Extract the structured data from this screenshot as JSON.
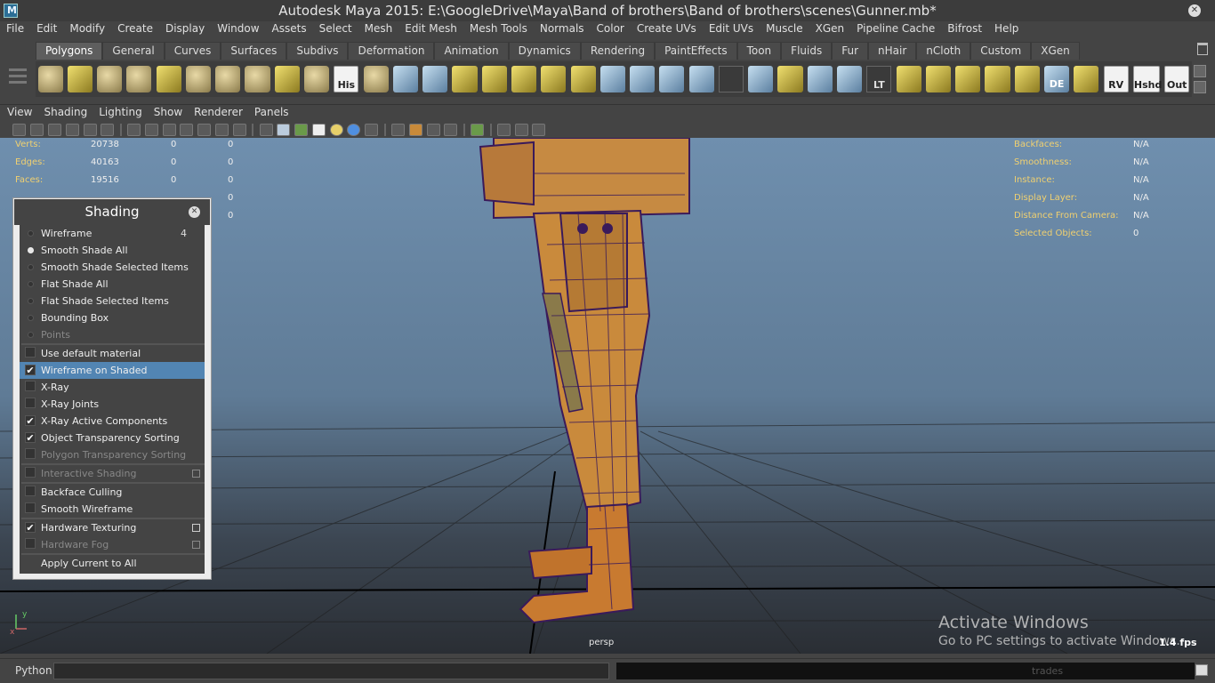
{
  "window": {
    "title": "Autodesk Maya 2015: E:\\GoogleDrive\\Maya\\Band of brothers\\Band of brothers\\scenes\\Gunner.mb*"
  },
  "menubar": [
    "File",
    "Edit",
    "Modify",
    "Create",
    "Display",
    "Window",
    "Assets",
    "Select",
    "Mesh",
    "Edit Mesh",
    "Mesh Tools",
    "Normals",
    "Color",
    "Create UVs",
    "Edit UVs",
    "Muscle",
    "XGen",
    "Pipeline Cache",
    "Bifrost",
    "Help"
  ],
  "shelf": {
    "tabs": [
      "Polygons",
      "General",
      "Curves",
      "Surfaces",
      "Subdivs",
      "Deformation",
      "Animation",
      "Dynamics",
      "Rendering",
      "PaintEffects",
      "Toon",
      "Fluids",
      "Fur",
      "nHair",
      "nCloth",
      "Custom",
      "XGen"
    ],
    "active_tab": "Polygons",
    "icon_labels": {
      "his": "His",
      "lt": "LT",
      "de": "DE",
      "rv": "RV",
      "hshd": "Hshd",
      "out": "Out"
    }
  },
  "panel_menu": [
    "View",
    "Shading",
    "Lighting",
    "Show",
    "Renderer",
    "Panels"
  ],
  "hud_left": [
    {
      "label": "Verts:",
      "v1": "20738",
      "v2": "0",
      "v3": "0"
    },
    {
      "label": "Edges:",
      "v1": "40163",
      "v2": "0",
      "v3": "0"
    },
    {
      "label": "Faces:",
      "v1": "19516",
      "v2": "0",
      "v3": "0"
    },
    {
      "label": "",
      "v1": "",
      "v2": "",
      "v3": "0"
    },
    {
      "label": "",
      "v1": "",
      "v2": "",
      "v3": "0"
    }
  ],
  "hud_right": [
    {
      "label": "Backfaces:",
      "value": "N/A"
    },
    {
      "label": "Smoothness:",
      "value": "N/A"
    },
    {
      "label": "Instance:",
      "value": "N/A"
    },
    {
      "label": "Display Layer:",
      "value": "N/A"
    },
    {
      "label": "Distance From Camera:",
      "value": "N/A"
    },
    {
      "label": "Selected Objects:",
      "value": "0"
    }
  ],
  "viewport": {
    "camera": "persp",
    "fps": "1.4 fps",
    "axis_y": "y",
    "axis_x": "x"
  },
  "shading_panel": {
    "title": "Shading",
    "items": [
      {
        "label": "Wireframe",
        "kind": "radio",
        "on": false,
        "extra": "4"
      },
      {
        "label": "Smooth Shade All",
        "kind": "radio",
        "on": true
      },
      {
        "label": "Smooth Shade Selected Items",
        "kind": "radio",
        "on": false
      },
      {
        "label": "Flat Shade All",
        "kind": "radio",
        "on": false
      },
      {
        "label": "Flat Shade Selected Items",
        "kind": "radio",
        "on": false
      },
      {
        "label": "Bounding Box",
        "kind": "radio",
        "on": false
      },
      {
        "label": "Points",
        "kind": "radio",
        "on": false,
        "disabled": true
      },
      {
        "kind": "sep"
      },
      {
        "label": "Use default material",
        "kind": "check",
        "on": false
      },
      {
        "label": "Wireframe on Shaded",
        "kind": "check",
        "on": true,
        "highlight": true
      },
      {
        "label": "X-Ray",
        "kind": "check",
        "on": false
      },
      {
        "label": "X-Ray Joints",
        "kind": "check",
        "on": false
      },
      {
        "label": "X-Ray Active Components",
        "kind": "check",
        "on": true
      },
      {
        "label": "Object Transparency Sorting",
        "kind": "check",
        "on": true
      },
      {
        "label": "Polygon Transparency Sorting",
        "kind": "check",
        "on": false,
        "disabled": true
      },
      {
        "kind": "sep"
      },
      {
        "label": "Interactive Shading",
        "kind": "check",
        "on": false,
        "disabled": true,
        "option_box": true
      },
      {
        "kind": "sep"
      },
      {
        "label": "Backface Culling",
        "kind": "check",
        "on": false
      },
      {
        "label": "Smooth Wireframe",
        "kind": "check",
        "on": false
      },
      {
        "kind": "sep"
      },
      {
        "label": "Hardware Texturing",
        "kind": "check",
        "on": true,
        "option_box": true
      },
      {
        "label": "Hardware Fog",
        "kind": "check",
        "on": false,
        "disabled": true,
        "option_box": true
      },
      {
        "kind": "sep"
      },
      {
        "label": "Apply Current to All",
        "kind": "action"
      }
    ]
  },
  "watermark": {
    "line1": "Activate Windows",
    "line2": "Go to PC settings to activate Windows."
  },
  "command_line": {
    "label": "Python",
    "ghost_text": "trades"
  },
  "colors": {
    "viewport_top": "#6f8fae",
    "leg": "#c98a3c",
    "wire": "#3a1a5a",
    "highlight": "#5285b3"
  }
}
